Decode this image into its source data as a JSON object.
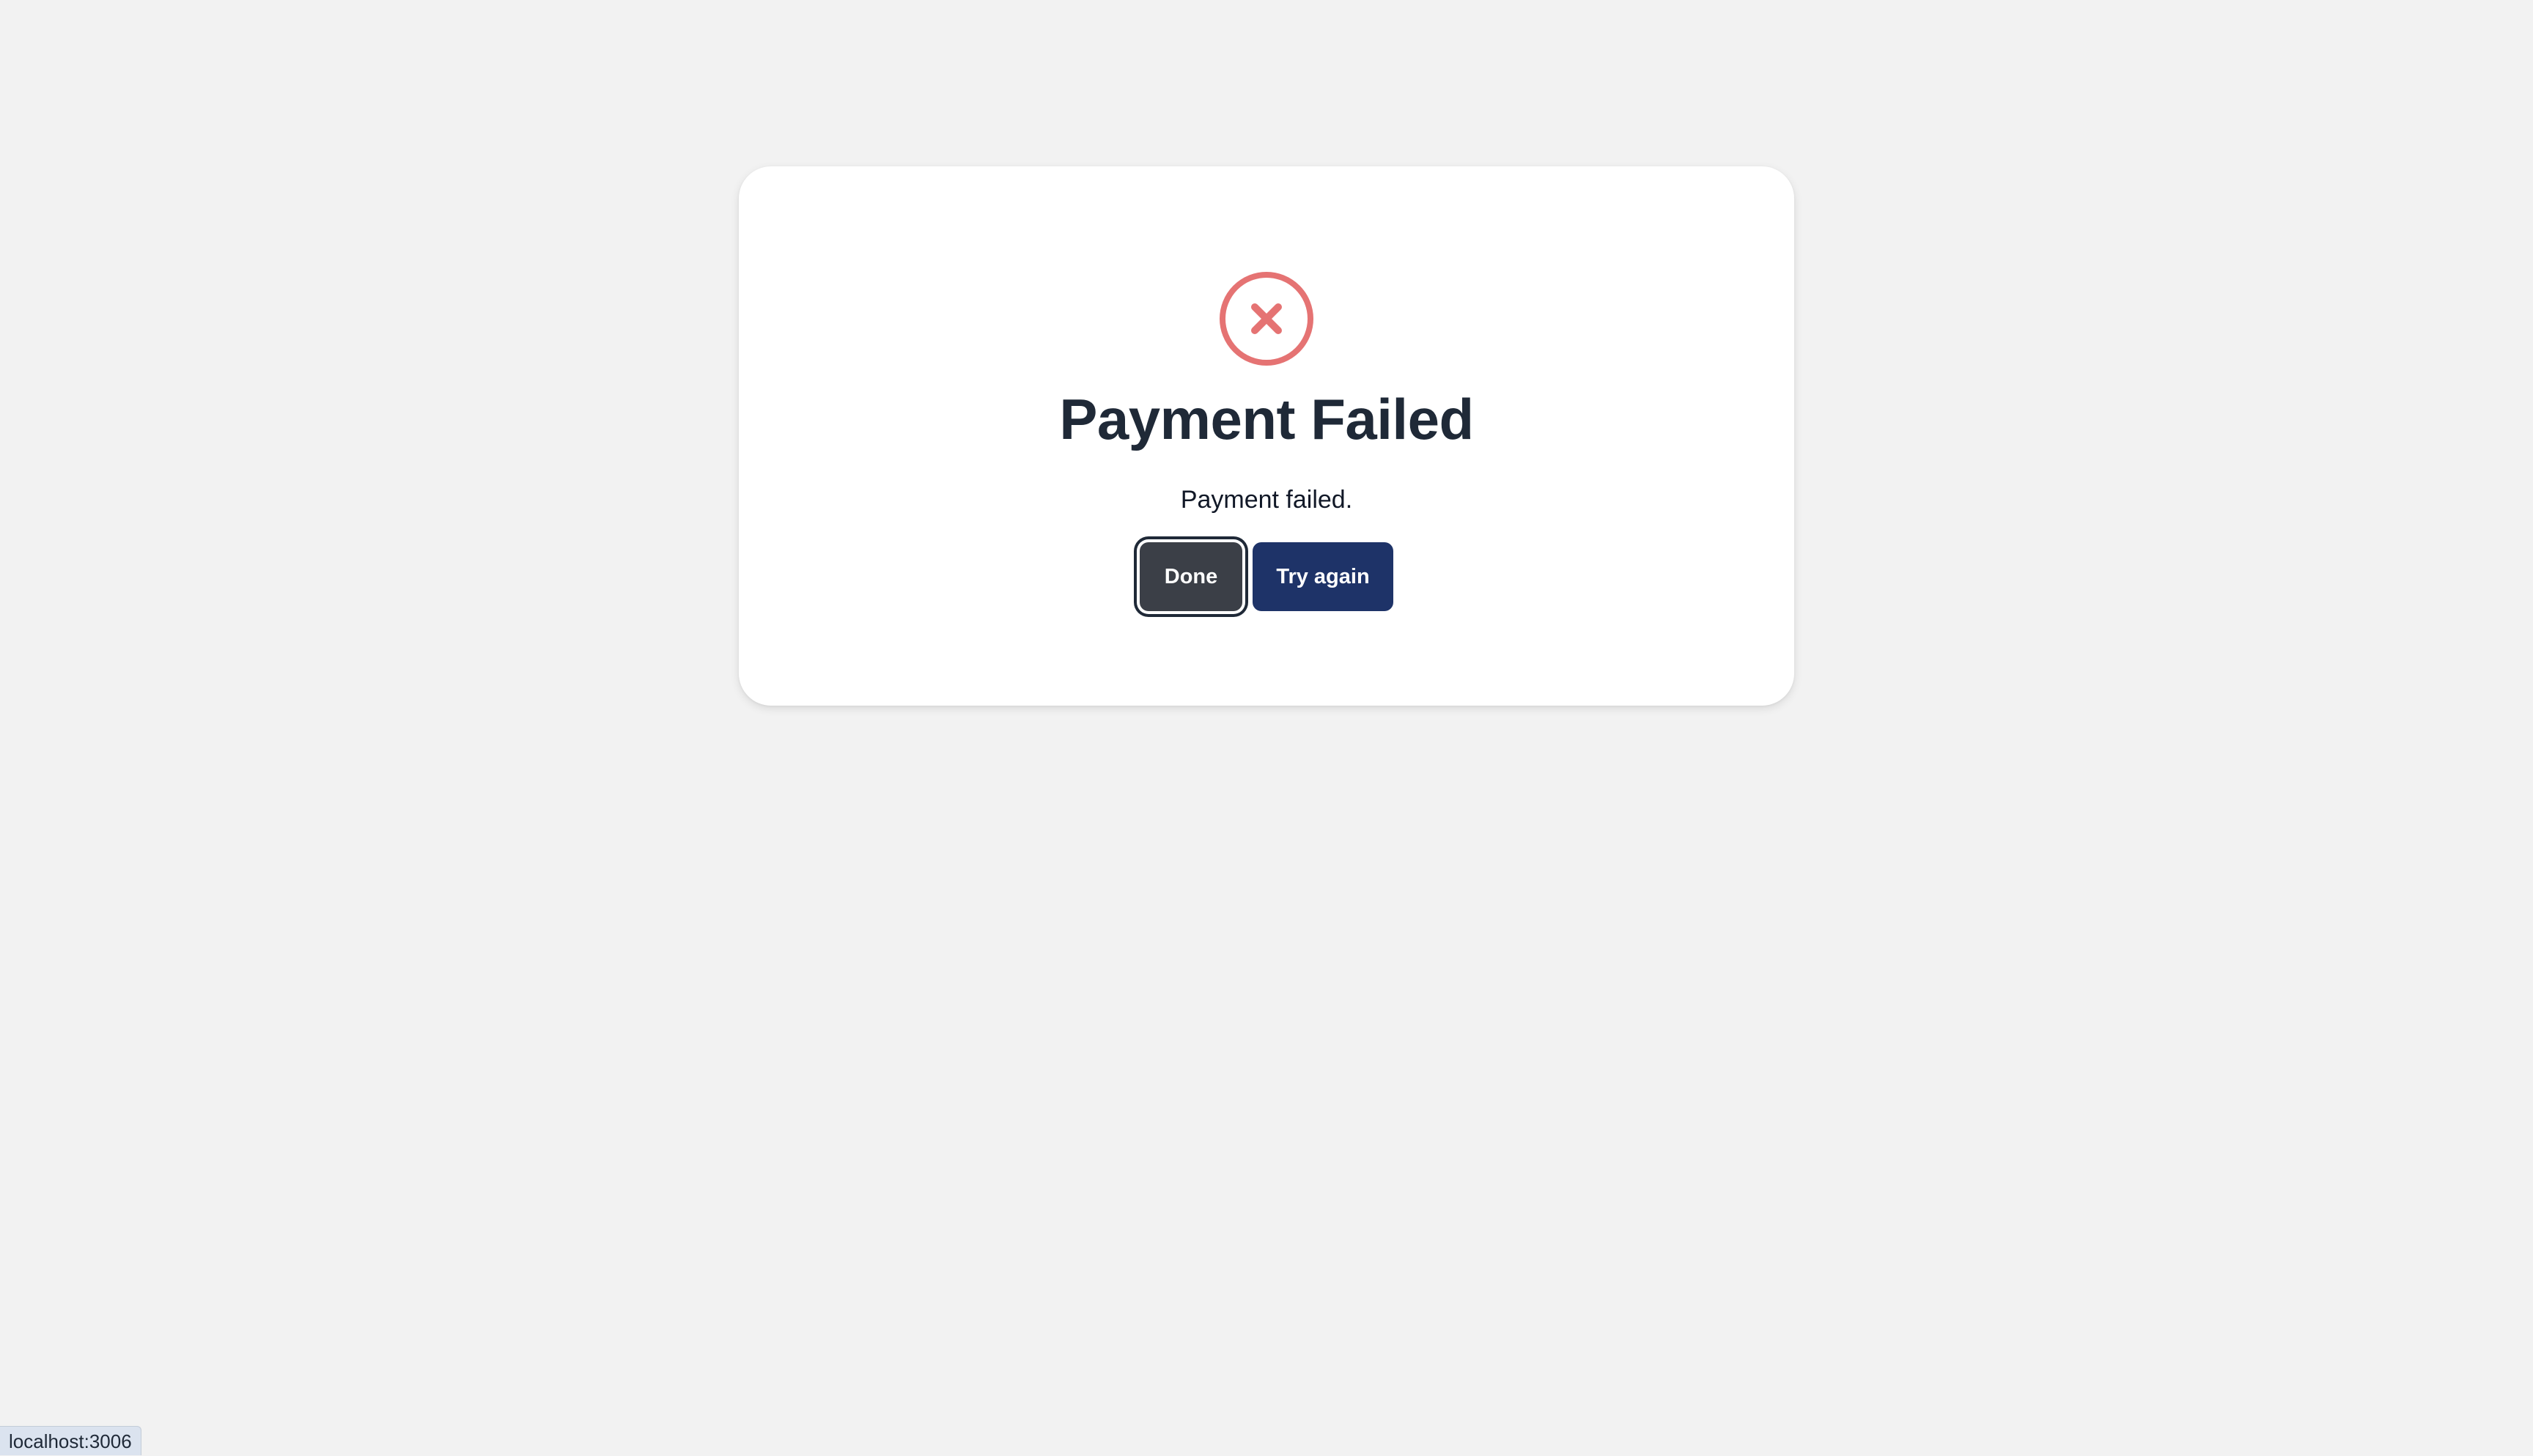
{
  "dialog": {
    "icon": "error-circle-x-icon",
    "title": "Payment Failed",
    "message": "Payment failed.",
    "done_label": "Done",
    "try_again_label": "Try again"
  },
  "status_bar": {
    "url": "localhost:3006"
  },
  "colors": {
    "page_background": "#f2f2f2",
    "card_background": "#ffffff",
    "error_icon": "#e57373",
    "title_text": "#1f2937",
    "done_button": "#3b3f47",
    "try_again_button": "#1e3368"
  }
}
